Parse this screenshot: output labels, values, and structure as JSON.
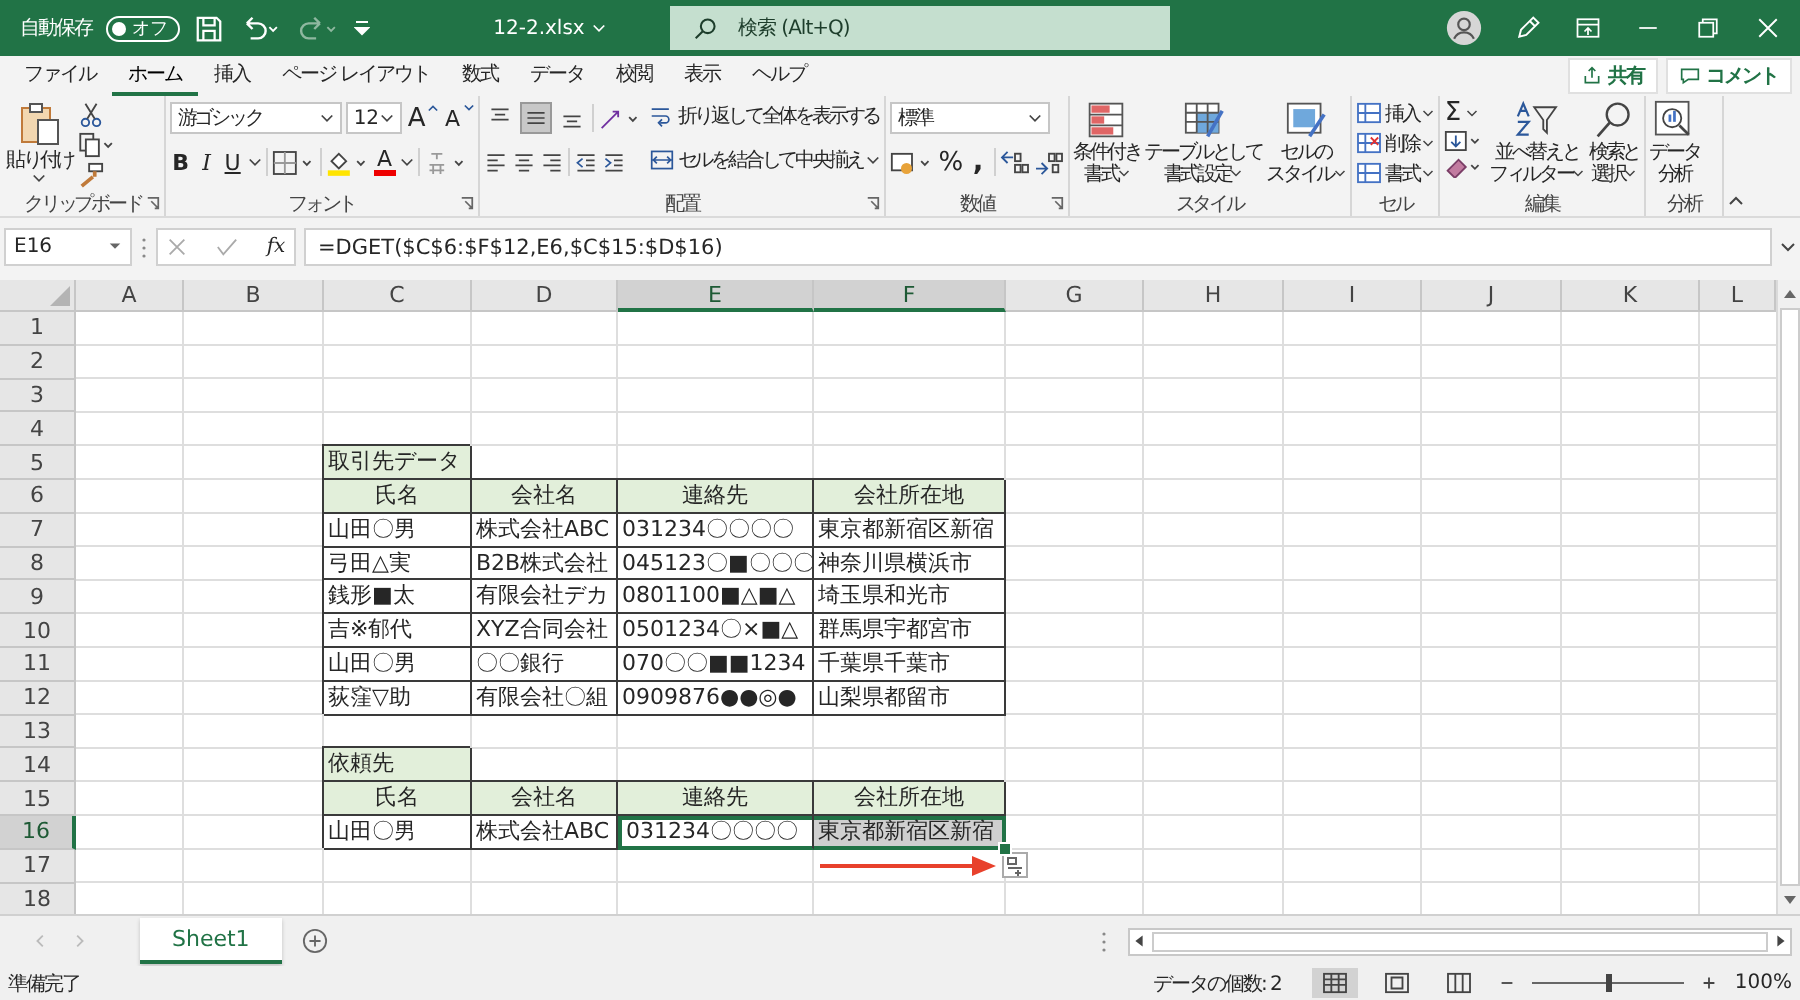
{
  "title_bar": {
    "autosave_label": "自動保存",
    "autosave": {
      "on": false,
      "label": "オフ"
    },
    "filename": "12-2.xlsx",
    "search_placeholder": "検索 (Alt+Q)"
  },
  "tabs": [
    {
      "label": "ファイル",
      "selected": false
    },
    {
      "label": "ホーム",
      "selected": true
    },
    {
      "label": "挿入",
      "selected": false
    },
    {
      "label": "ページ レイアウト",
      "selected": false
    },
    {
      "label": "数式",
      "selected": false
    },
    {
      "label": "データ",
      "selected": false
    },
    {
      "label": "校閲",
      "selected": false
    },
    {
      "label": "表示",
      "selected": false
    },
    {
      "label": "ヘルプ",
      "selected": false
    }
  ],
  "share_button": "共有",
  "comment_button": "コメント",
  "ribbon": {
    "clipboard": {
      "paste": "貼り付け",
      "label": "クリップボード"
    },
    "font": {
      "name": "游ゴシック",
      "size": "12",
      "grow": "A",
      "shrink": "A",
      "bold": "B",
      "italic": "I",
      "underline": "U",
      "font_color": "A",
      "label": "フォント"
    },
    "alignment": {
      "vertical_align_buttons": [
        {
          "selected": false
        },
        {
          "selected": true
        },
        {
          "selected": false
        }
      ],
      "wrap_text": "折り返して全体を表示する",
      "merge_center": "セルを結合して中央揃え",
      "label": "配置"
    },
    "number": {
      "format": "標準",
      "percent": "%",
      "comma": ",",
      "label": "数値"
    },
    "styles": {
      "buttons": [
        {
          "lines": [
            "条件付き",
            "書式"
          ]
        },
        {
          "lines": [
            "テーブルとして",
            "書式設定"
          ]
        },
        {
          "lines": [
            "セルの",
            "スタイル"
          ]
        }
      ],
      "label": "スタイル"
    },
    "cells": {
      "buttons": [
        "挿入",
        "削除",
        "書式"
      ],
      "label": "セル"
    },
    "editing": {
      "autosum": "Σ",
      "buttons": [
        {
          "lines": [
            "並べ替えと",
            "フィルター"
          ]
        },
        {
          "lines": [
            "検索と",
            "選択"
          ]
        }
      ],
      "label": "編集"
    },
    "analysis": {
      "buttons": [
        {
          "lines": [
            "データ",
            "分析"
          ]
        }
      ],
      "label": "分析"
    }
  },
  "formula_bar": {
    "name_box": "E16",
    "fx": "fx",
    "formula": "=DGET($C$6:$F$12,E6,$C$15:$D$16)"
  },
  "sheet": {
    "columns": [
      {
        "label": "A",
        "selected": false
      },
      {
        "label": "B",
        "selected": false
      },
      {
        "label": "C",
        "selected": false
      },
      {
        "label": "D",
        "selected": false
      },
      {
        "label": "E",
        "selected": true
      },
      {
        "label": "F",
        "selected": true
      },
      {
        "label": "G",
        "selected": false
      },
      {
        "label": "H",
        "selected": false
      },
      {
        "label": "I",
        "selected": false
      },
      {
        "label": "J",
        "selected": false
      },
      {
        "label": "K",
        "selected": false
      },
      {
        "label": "L",
        "selected": false
      }
    ],
    "rows": [
      {
        "number": "1",
        "selected": false
      },
      {
        "number": "2",
        "selected": false
      },
      {
        "number": "3",
        "selected": false
      },
      {
        "number": "4",
        "selected": false
      },
      {
        "number": "5",
        "selected": false,
        "cells": [
          {
            "text": "取引先データ",
            "kind": "title",
            "selected": false
          }
        ]
      },
      {
        "number": "6",
        "selected": false,
        "cells": [
          {
            "text": "氏名",
            "kind": "header",
            "selected": false
          },
          {
            "text": "会社名",
            "kind": "header",
            "selected": false
          },
          {
            "text": "連絡先",
            "kind": "header",
            "selected": false
          },
          {
            "text": "会社所在地",
            "kind": "header",
            "selected": false
          }
        ]
      },
      {
        "number": "7",
        "selected": false,
        "cells": [
          {
            "text": "山田〇男",
            "kind": "data",
            "selected": false
          },
          {
            "text": "株式会社ABC",
            "kind": "data",
            "selected": false
          },
          {
            "text": "031234〇〇〇〇",
            "kind": "data",
            "selected": false
          },
          {
            "text": "東京都新宿区新宿",
            "kind": "data",
            "selected": false
          }
        ]
      },
      {
        "number": "8",
        "selected": false,
        "cells": [
          {
            "text": "弓田△実",
            "kind": "data",
            "selected": false
          },
          {
            "text": "B2B株式会社",
            "kind": "data",
            "selected": false
          },
          {
            "text": "045123〇■〇〇〇",
            "kind": "data",
            "selected": false
          },
          {
            "text": "神奈川県横浜市",
            "kind": "data",
            "selected": false
          }
        ]
      },
      {
        "number": "9",
        "selected": false,
        "cells": [
          {
            "text": "銭形■太",
            "kind": "data",
            "selected": false
          },
          {
            "text": "有限会社デカ",
            "kind": "data",
            "selected": false
          },
          {
            "text": "0801100■△■△",
            "kind": "data",
            "selected": false
          },
          {
            "text": "埼玉県和光市",
            "kind": "data",
            "selected": false
          }
        ]
      },
      {
        "number": "10",
        "selected": false,
        "cells": [
          {
            "text": "吉※郁代",
            "kind": "data",
            "selected": false
          },
          {
            "text": "XYZ合同会社",
            "kind": "data",
            "selected": false
          },
          {
            "text": "0501234〇×■△",
            "kind": "data",
            "selected": false
          },
          {
            "text": "群馬県宇都宮市",
            "kind": "data",
            "selected": false
          }
        ]
      },
      {
        "number": "11",
        "selected": false,
        "cells": [
          {
            "text": "山田〇男",
            "kind": "data",
            "selected": false
          },
          {
            "text": "〇〇銀行",
            "kind": "data",
            "selected": false
          },
          {
            "text": "070〇〇■■1234",
            "kind": "data",
            "selected": false
          },
          {
            "text": "千葉県千葉市",
            "kind": "data",
            "selected": false
          }
        ]
      },
      {
        "number": "12",
        "selected": false,
        "cells": [
          {
            "text": "荻窪▽助",
            "kind": "data",
            "selected": false
          },
          {
            "text": "有限会社〇組",
            "kind": "data",
            "selected": false
          },
          {
            "text": "0909876●●◎●",
            "kind": "data",
            "selected": false
          },
          {
            "text": "山梨県都留市",
            "kind": "data",
            "selected": false
          }
        ]
      },
      {
        "number": "13",
        "selected": false
      },
      {
        "number": "14",
        "selected": false,
        "cells": [
          {
            "text": "依頼先",
            "kind": "title",
            "selected": false
          }
        ]
      },
      {
        "number": "15",
        "selected": false,
        "cells": [
          {
            "text": "氏名",
            "kind": "header",
            "selected": false
          },
          {
            "text": "会社名",
            "kind": "header",
            "selected": false
          },
          {
            "text": "連絡先",
            "kind": "header",
            "selected": false
          },
          {
            "text": "会社所在地",
            "kind": "header",
            "selected": false
          }
        ]
      },
      {
        "number": "16",
        "selected": true,
        "cells": [
          {
            "text": "山田〇男",
            "kind": "data",
            "selected": false
          },
          {
            "text": "株式会社ABC",
            "kind": "data",
            "selected": false
          },
          {
            "text": "031234〇〇〇〇",
            "kind": "data",
            "selected": true
          },
          {
            "text": "東京都新宿区新宿",
            "kind": "data",
            "selected": true
          }
        ]
      },
      {
        "number": "17",
        "selected": false
      },
      {
        "number": "18",
        "selected": false
      }
    ]
  },
  "sheet_tabs": [
    {
      "label": "Sheet1",
      "selected": true
    }
  ],
  "status_bar": {
    "status": "準備完了",
    "count": "データの個数: 2",
    "views": [
      {
        "selected": true
      },
      {
        "selected": false
      },
      {
        "selected": false
      }
    ],
    "zoom": {
      "level": 0.5,
      "reading": "100%"
    }
  }
}
